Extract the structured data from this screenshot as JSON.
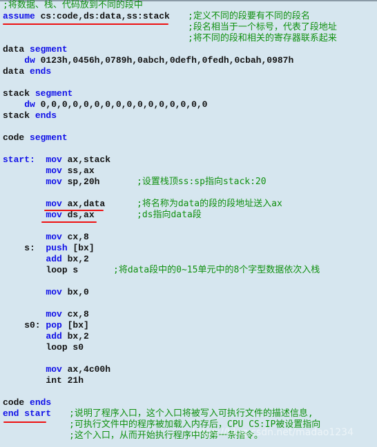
{
  "code": [
    {
      "segs": [],
      "comment": ";将数据、栈、代码放到不同的段中"
    },
    {
      "segs": [
        [
          "k",
          "assume"
        ],
        [
          "n",
          " cs:code,ds:data,ss:stack"
        ]
      ],
      "comment": ";定义不同的段要有不同的段名"
    },
    {
      "segs": [],
      "comment": ";段名相当于一个标号，代表了段地址"
    },
    {
      "segs": [],
      "comment": ";将不同的段和相关的寄存器联系起来"
    },
    {
      "segs": [
        [
          "n",
          "data "
        ],
        [
          "k",
          "segment"
        ]
      ]
    },
    {
      "segs": [
        [
          "n",
          "    "
        ],
        [
          "k",
          "dw"
        ],
        [
          "n",
          " 0123h,0456h,0789h,0abch,0defh,0fedh,0cbah,0987h"
        ]
      ]
    },
    {
      "segs": [
        [
          "n",
          "data "
        ],
        [
          "k",
          "ends"
        ]
      ]
    },
    {
      "segs": []
    },
    {
      "segs": [
        [
          "n",
          "stack "
        ],
        [
          "k",
          "segment"
        ]
      ]
    },
    {
      "segs": [
        [
          "n",
          "    "
        ],
        [
          "k",
          "dw"
        ],
        [
          "n",
          " 0,0,0,0,0,0,0,0,0,0,0,0,0,0,0,0"
        ]
      ]
    },
    {
      "segs": [
        [
          "n",
          "stack "
        ],
        [
          "k",
          "ends"
        ]
      ]
    },
    {
      "segs": []
    },
    {
      "segs": [
        [
          "n",
          "code "
        ],
        [
          "k",
          "segment"
        ]
      ]
    },
    {
      "segs": []
    },
    {
      "segs": [
        [
          "k",
          "start:"
        ],
        [
          "n",
          "  "
        ],
        [
          "k",
          "mov"
        ],
        [
          "n",
          " ax,stack"
        ]
      ]
    },
    {
      "segs": [
        [
          "n",
          "        "
        ],
        [
          "k",
          "mov"
        ],
        [
          "n",
          " ss,ax"
        ]
      ]
    },
    {
      "segs": [
        [
          "n",
          "        "
        ],
        [
          "k",
          "mov"
        ],
        [
          "n",
          " sp,20h"
        ]
      ],
      "comment": ";设置栈顶ss:sp指向stack:20"
    },
    {
      "segs": []
    },
    {
      "segs": [
        [
          "n",
          "        "
        ],
        [
          "k",
          "mov"
        ],
        [
          "n",
          " ax,data"
        ]
      ],
      "comment": ";将名称为data的段的段地址送入ax"
    },
    {
      "segs": [
        [
          "n",
          "        "
        ],
        [
          "k",
          "mov"
        ],
        [
          "n",
          " ds,ax"
        ]
      ],
      "comment": ";ds指向data段"
    },
    {
      "segs": []
    },
    {
      "segs": [
        [
          "n",
          "        "
        ],
        [
          "k",
          "mov"
        ],
        [
          "n",
          " cx,8"
        ]
      ]
    },
    {
      "segs": [
        [
          "n",
          "    s:  "
        ],
        [
          "k",
          "push"
        ],
        [
          "n",
          " [bx]"
        ]
      ]
    },
    {
      "segs": [
        [
          "n",
          "        "
        ],
        [
          "k",
          "add"
        ],
        [
          "n",
          " bx,2"
        ]
      ]
    },
    {
      "segs": [
        [
          "n",
          "        loop s"
        ]
      ],
      "comment": ";将data段中的0~15单元中的8个字型数据依次入栈"
    },
    {
      "segs": []
    },
    {
      "segs": [
        [
          "n",
          "        "
        ],
        [
          "k",
          "mov"
        ],
        [
          "n",
          " bx,0"
        ]
      ]
    },
    {
      "segs": []
    },
    {
      "segs": [
        [
          "n",
          "        "
        ],
        [
          "k",
          "mov"
        ],
        [
          "n",
          " cx,8"
        ]
      ]
    },
    {
      "segs": [
        [
          "n",
          "    s0: "
        ],
        [
          "k",
          "pop"
        ],
        [
          "n",
          " [bx]"
        ]
      ]
    },
    {
      "segs": [
        [
          "n",
          "        "
        ],
        [
          "k",
          "add"
        ],
        [
          "n",
          " bx,2"
        ]
      ]
    },
    {
      "segs": [
        [
          "n",
          "        loop s0"
        ]
      ]
    },
    {
      "segs": []
    },
    {
      "segs": [
        [
          "n",
          "        "
        ],
        [
          "k",
          "mov"
        ],
        [
          "n",
          " ax,4c00h"
        ]
      ]
    },
    {
      "segs": [
        [
          "n",
          "        int 21h"
        ]
      ]
    },
    {
      "segs": []
    },
    {
      "segs": [
        [
          "n",
          "code "
        ],
        [
          "k",
          "ends"
        ]
      ]
    },
    {
      "segs": [
        [
          "k",
          "end start"
        ]
      ],
      "comment": ";说明了程序入口，这个入口将被写入可执行文件的描述信息,"
    },
    {
      "segs": [],
      "comment": ";可执行文件中的程序被加载入内存后，CPU CS:IP被设置指向"
    },
    {
      "segs": [],
      "comment": ";这个入口，从而开始执行程序中的第一条指令。"
    }
  ],
  "watermark": "https://blog.csdn.net/madao1234",
  "colors": {
    "background": "#d6e6ef",
    "keyword": "#1010e8",
    "comment": "#109010",
    "underline": "#ee1010"
  }
}
